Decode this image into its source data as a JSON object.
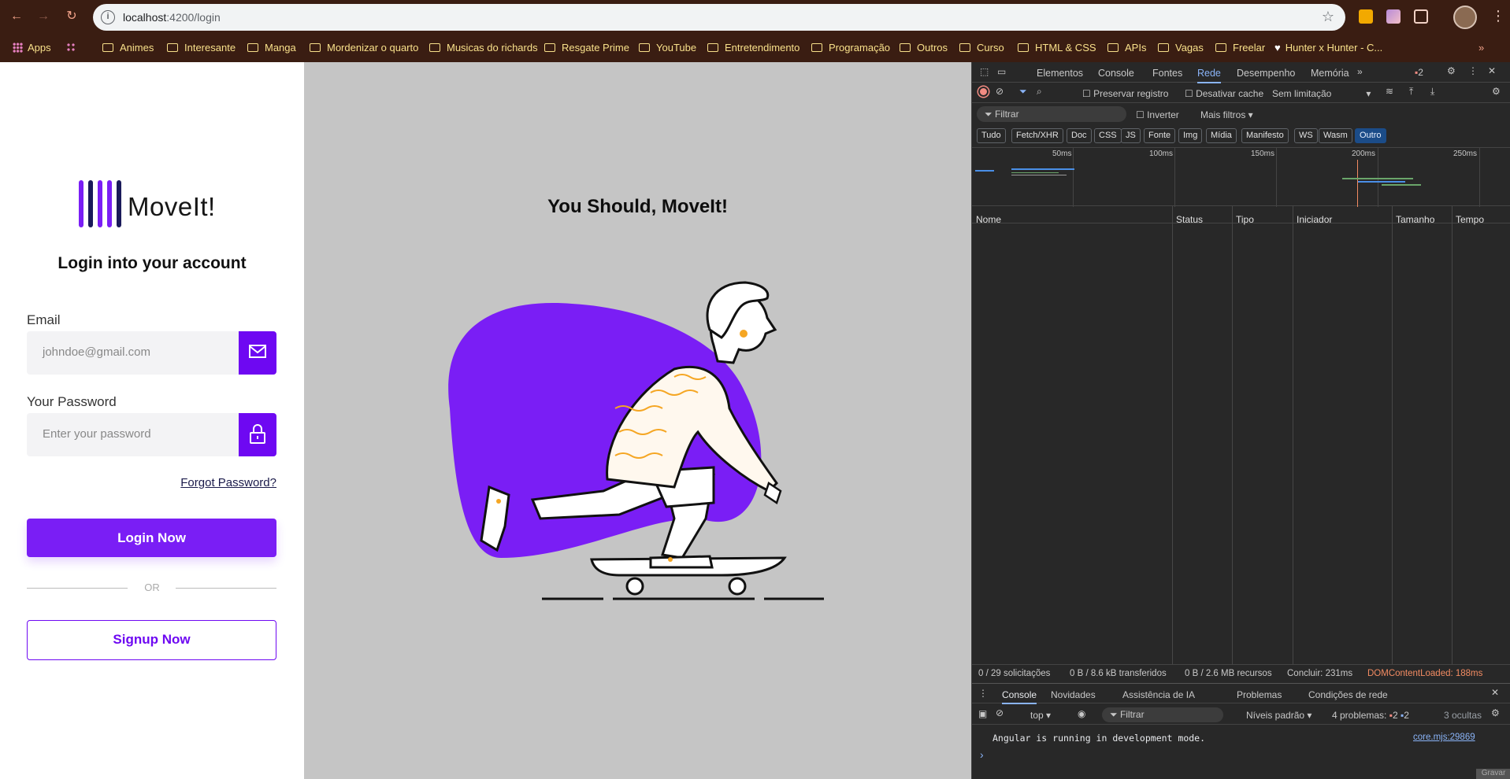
{
  "browser": {
    "url_host": "localhost",
    "url_rest": ":4200/login",
    "bookmarks": [
      {
        "label": "Apps",
        "type": "apps"
      },
      {
        "label": "Animes",
        "type": "folder"
      },
      {
        "label": "Interesante",
        "type": "folder"
      },
      {
        "label": "Manga",
        "type": "folder"
      },
      {
        "label": "Mordenizar o quarto",
        "type": "folder"
      },
      {
        "label": "Musicas do richards",
        "type": "folder"
      },
      {
        "label": "Resgate Prime",
        "type": "folder"
      },
      {
        "label": "YouTube",
        "type": "folder"
      },
      {
        "label": "Entretendimento",
        "type": "folder"
      },
      {
        "label": "Programação",
        "type": "folder"
      },
      {
        "label": "Outros",
        "type": "folder"
      },
      {
        "label": "Curso",
        "type": "folder"
      },
      {
        "label": "HTML & CSS",
        "type": "folder"
      },
      {
        "label": "APIs",
        "type": "folder"
      },
      {
        "label": "Vagas",
        "type": "folder"
      },
      {
        "label": "Freelar",
        "type": "folder"
      },
      {
        "label": "Hunter x Hunter - C...",
        "type": "heart"
      }
    ],
    "more": "»"
  },
  "login": {
    "brand": "MoveIt!",
    "heading": "Login into your account",
    "email_label": "Email",
    "email_placeholder": "johndoe@gmail.com",
    "password_label": "Your Password",
    "password_placeholder": "Enter your password",
    "forgot": "Forgot Password?",
    "login_button": "Login Now",
    "or": "OR",
    "signup_button": "Signup Now",
    "accent": "#6e08f2"
  },
  "hero": {
    "tagline": "You Should, MoveIt!",
    "blob_color": "#7a1ef5"
  },
  "devtools": {
    "tabs": [
      "Elementos",
      "Console",
      "Fontes",
      "Rede",
      "Desempenho",
      "Memória"
    ],
    "active_tab": "Rede",
    "issues_badge": "2",
    "toolbar": {
      "preserve": "Preservar registro",
      "disable_cache": "Desativar cache",
      "throttle": "Sem limitação"
    },
    "filter_placeholder": "Filtrar",
    "invert": "Inverter",
    "more_filters": "Mais filtros",
    "type_chips": [
      "Tudo",
      "Fetch/XHR",
      "Doc",
      "CSS",
      "JS",
      "Fonte",
      "Img",
      "Mídia",
      "Manifesto",
      "WS",
      "Wasm",
      "Outro"
    ],
    "active_chip": "Outro",
    "timeline_ticks": [
      "50ms",
      "100ms",
      "150ms",
      "200ms",
      "250ms"
    ],
    "columns": [
      "Nome",
      "Status",
      "Tipo",
      "Iniciador",
      "Tamanho",
      "Tempo"
    ],
    "status": {
      "requests": "0 / 29 solicitações",
      "transferred": "0 B / 8.6 kB transferidos",
      "resources": "0 B / 2.6 MB recursos",
      "finish": "Concluir: 231ms",
      "dcl": "DOMContentLoaded: 188ms"
    },
    "drawer_tabs": [
      "Console",
      "Novidades",
      "Assistência de IA",
      "Problemas",
      "Condições de rede"
    ],
    "console": {
      "context": "top",
      "filter_placeholder": "Filtrar",
      "levels": "Níveis padrão",
      "problems_label": "4 problemas:",
      "problems_err": "2",
      "problems_info": "2",
      "hidden": "3 ocultas",
      "message": "Angular is running in development mode.",
      "source": "core.mjs:29869",
      "prompt": "›"
    },
    "record_btn": "Gravar"
  }
}
